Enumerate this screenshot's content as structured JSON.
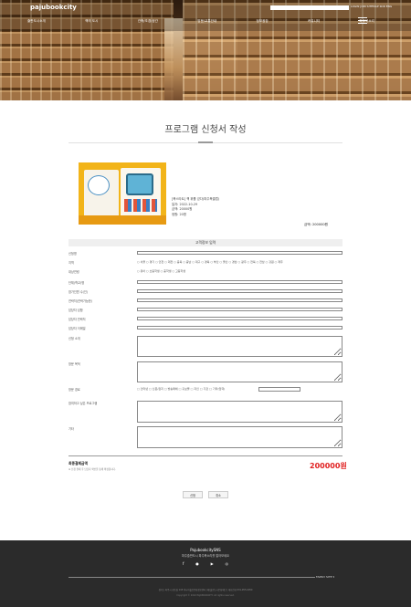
{
  "header": {
    "logo": "pajubookcity",
    "search_placeholder": "",
    "util_links": "LOGIN  JOIN  SITEMAP  KOR  ENG",
    "nav": [
      "출판도시소개",
      "책의 도시",
      "건축/조경/공간",
      "방문/교통안내",
      "정보광장",
      "커뮤니티",
      "파주북소리"
    ]
  },
  "page_title": "프로그램 신청서 작성",
  "program": {
    "name": "[북스타트] 책 위를 걷다(파주북클럽)",
    "date": "일자: 2022-10-29",
    "fee": "금액: 20000원",
    "seats": "정원: 20명",
    "price": "금액: 200000원"
  },
  "form": {
    "header": "고객정보 입력",
    "labels": {
      "name": "신청명",
      "region": "지역",
      "target": "대상연령",
      "group_name": "단체(학교)명",
      "leader_count": "참가인원 수(인)",
      "phone": "연락처(연락가능한)",
      "contact_name": "담당자 성함",
      "contact_phone": "담당자 연락처",
      "contact_email": "담당자 이메일",
      "request": "신청 소개",
      "visit_purpose": "방문 목적",
      "visit_route": "방문 경로",
      "other_program": "참여하고 싶은 프로그램",
      "etc": "기타"
    },
    "region_options": "○ 서울  ○ 경기  ○ 인천  ○ 대전  ○ 충북  ○ 충남  ○ 대구  ○ 경북  ○ 부산  ○ 울산  ○ 경남  ○ 광주  ○ 전북  ○ 전남  ○ 강원  ○ 제주",
    "target_options": "○ 유아  ○ 초등학생  ○ 중학생  ○ 고등학생",
    "route_options": "□ 인터넷  □ 신문/잡지  □ 방송매체  □ 홍보물  □ 지인  □ 기관  □ 기타(입력)"
  },
  "total": {
    "label": "최종결제금액",
    "note": "※ 신청 결제 후 담당자 확인을 통해 확정됩니다.",
    "amount": "200000원"
  },
  "buttons": {
    "submit": "신청",
    "cancel": "취소"
  },
  "footer": {
    "name": "PajubookcitySNS",
    "sub": "파주출판도시 파주북소리를 알아보세요",
    "sns_icons": [
      "facebook-icon",
      "blog-icon",
      "youtube-icon",
      "instagram-icon"
    ],
    "family_site": "FAMILY SITE",
    "address": "경기도 파주시 회동길 145 아시아출판문화정보센터 (재)출판도시문화재단 | 대표전화 031-955-0050",
    "copyright": "Copyright © 2022 PAJUBOOKCITY. All rights reserved."
  }
}
